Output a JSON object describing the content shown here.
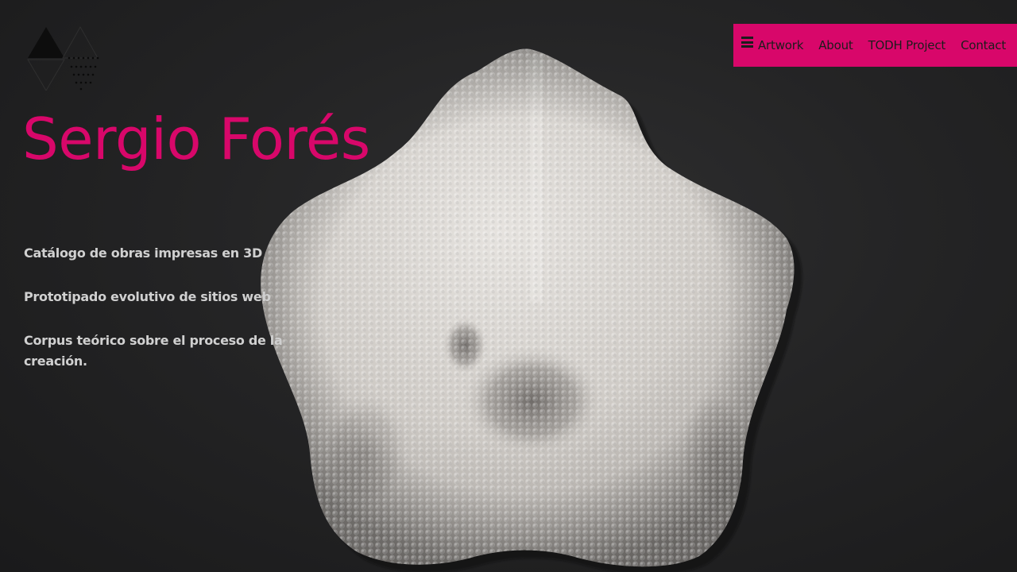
{
  "brand": {
    "logo_icon": "triangles-logo-icon",
    "accent_color": "#d8076a"
  },
  "nav": {
    "menu_icon": "hamburger-menu-icon",
    "items": [
      {
        "label": "Artwork"
      },
      {
        "label": "About"
      },
      {
        "label": "TODH Project"
      },
      {
        "label": "Contact"
      }
    ]
  },
  "hero": {
    "title": "Sergio Forés",
    "background_image": "white-textured-3d-printed-sculpture"
  },
  "links": [
    {
      "label": "Catálogo de obras impresas en 3D"
    },
    {
      "label": "Prototipado evolutivo de sitios web"
    },
    {
      "label": "Corpus teórico sobre el proceso de la creación."
    }
  ]
}
